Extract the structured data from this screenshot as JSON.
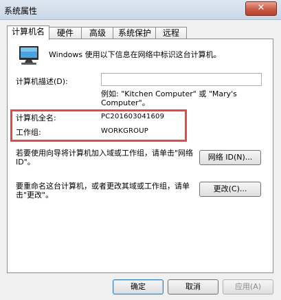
{
  "window": {
    "title": "系统属性",
    "close_label": "✕"
  },
  "tabs": [
    {
      "label": "计算机名",
      "active": true
    },
    {
      "label": "硬件"
    },
    {
      "label": "高级"
    },
    {
      "label": "系统保护"
    },
    {
      "label": "远程"
    }
  ],
  "panel": {
    "intro": "Windows 使用以下信息在网络中标识这台计算机。",
    "description_label": "计算机描述(D):",
    "description_value": "",
    "example_text": "例如: \"Kitchen Computer\" 或 \"Mary's Computer\"。",
    "full_name_label": "计算机全名:",
    "full_name_value": "PC201603041609",
    "workgroup_label": "工作组:",
    "workgroup_value": "WORKGROUP",
    "network_id_text": "若要使用向导将计算机加入域或工作组，请单击\"网络 ID\"。",
    "network_id_button": "网络 ID(N)...",
    "rename_text": "要重命名这台计算机，或者更改其域或工作组，请单击\"更改\"。",
    "change_button": "更改(C)..."
  },
  "footer": {
    "ok_label": "确定",
    "cancel_label": "取消",
    "apply_label": "应用(A)"
  }
}
